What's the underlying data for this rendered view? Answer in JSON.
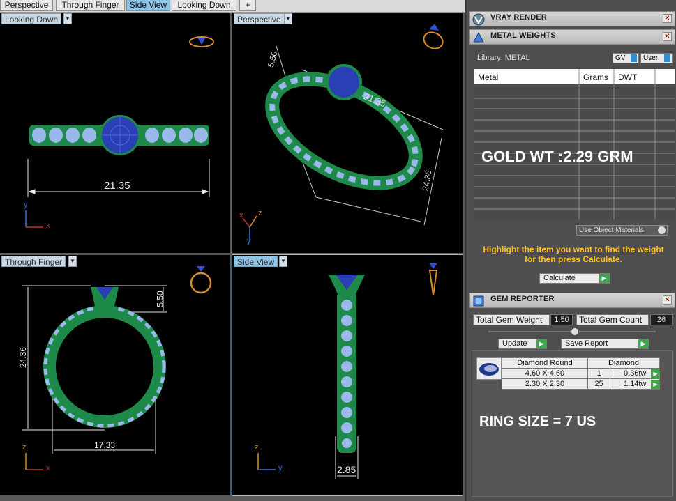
{
  "tabs": [
    {
      "label": "Perspective",
      "active": false
    },
    {
      "label": "Through Finger",
      "active": false
    },
    {
      "label": "Side View",
      "active": true
    },
    {
      "label": "Looking Down",
      "active": false
    },
    {
      "label": "+",
      "active": false
    }
  ],
  "viewports": {
    "looking_down": {
      "label": "Looking Down",
      "dim": "21.35",
      "axis_y": "y",
      "axis_x": "x"
    },
    "perspective": {
      "label": "Perspective",
      "dim_a": "5.50",
      "dim_b": "21.35",
      "dim_c": "24.36",
      "axis_z": "z",
      "axis_x": "x",
      "axis_y": "y"
    },
    "through_finger": {
      "label": "Through Finger",
      "dim_height": "24.36",
      "dim_top": "5.50",
      "dim_width": "17.33",
      "axis_z": "z",
      "axis_x": "x"
    },
    "side_view": {
      "label": "Side View",
      "dim": "2.85",
      "axis_z": "z",
      "axis_y": "y"
    }
  },
  "panel": {
    "vray": {
      "title": "VRAY RENDER"
    },
    "metal": {
      "title": "METAL WEIGHTS",
      "library_label": "Library: METAL",
      "gv_label": "GV",
      "user_label": "User",
      "columns": [
        "Metal",
        "Grams",
        "DWT"
      ],
      "overlay_text": "GOLD WT :2.29 GRM",
      "use_object_materials": "Use Object Materials",
      "hint": "Highlight the item you want to find the weight for then press Calculate.",
      "calculate": "Calculate"
    },
    "gem": {
      "title": "GEM REPORTER",
      "total_weight_label": "Total Gem Weight",
      "total_weight_value": "1.50",
      "total_count_label": "Total Gem Count",
      "total_count_value": "26",
      "update": "Update",
      "save_report": "Save Report",
      "header_shape": "Diamond Round",
      "header_type": "Diamond",
      "rows": [
        {
          "size": "4.60 X 4.60",
          "count": "1",
          "weight": "0.36tw"
        },
        {
          "size": "2.30 X 2.30",
          "count": "25",
          "weight": "1.14tw"
        }
      ],
      "ring_size": "RING SIZE = 7 US"
    }
  },
  "colors": {
    "band": "#1d8a4a",
    "stones": "#9ab8ea",
    "center": "#2a3fb3",
    "dim": "#e8e8e8",
    "accent": "#8ec5e6"
  },
  "icons": [
    "dropdown-arrow-icon",
    "ring-thumbnail-icon",
    "vray-icon",
    "metal-weights-icon",
    "gem-reporter-icon",
    "close-icon",
    "play-arrow-icon",
    "diamond-icon"
  ]
}
